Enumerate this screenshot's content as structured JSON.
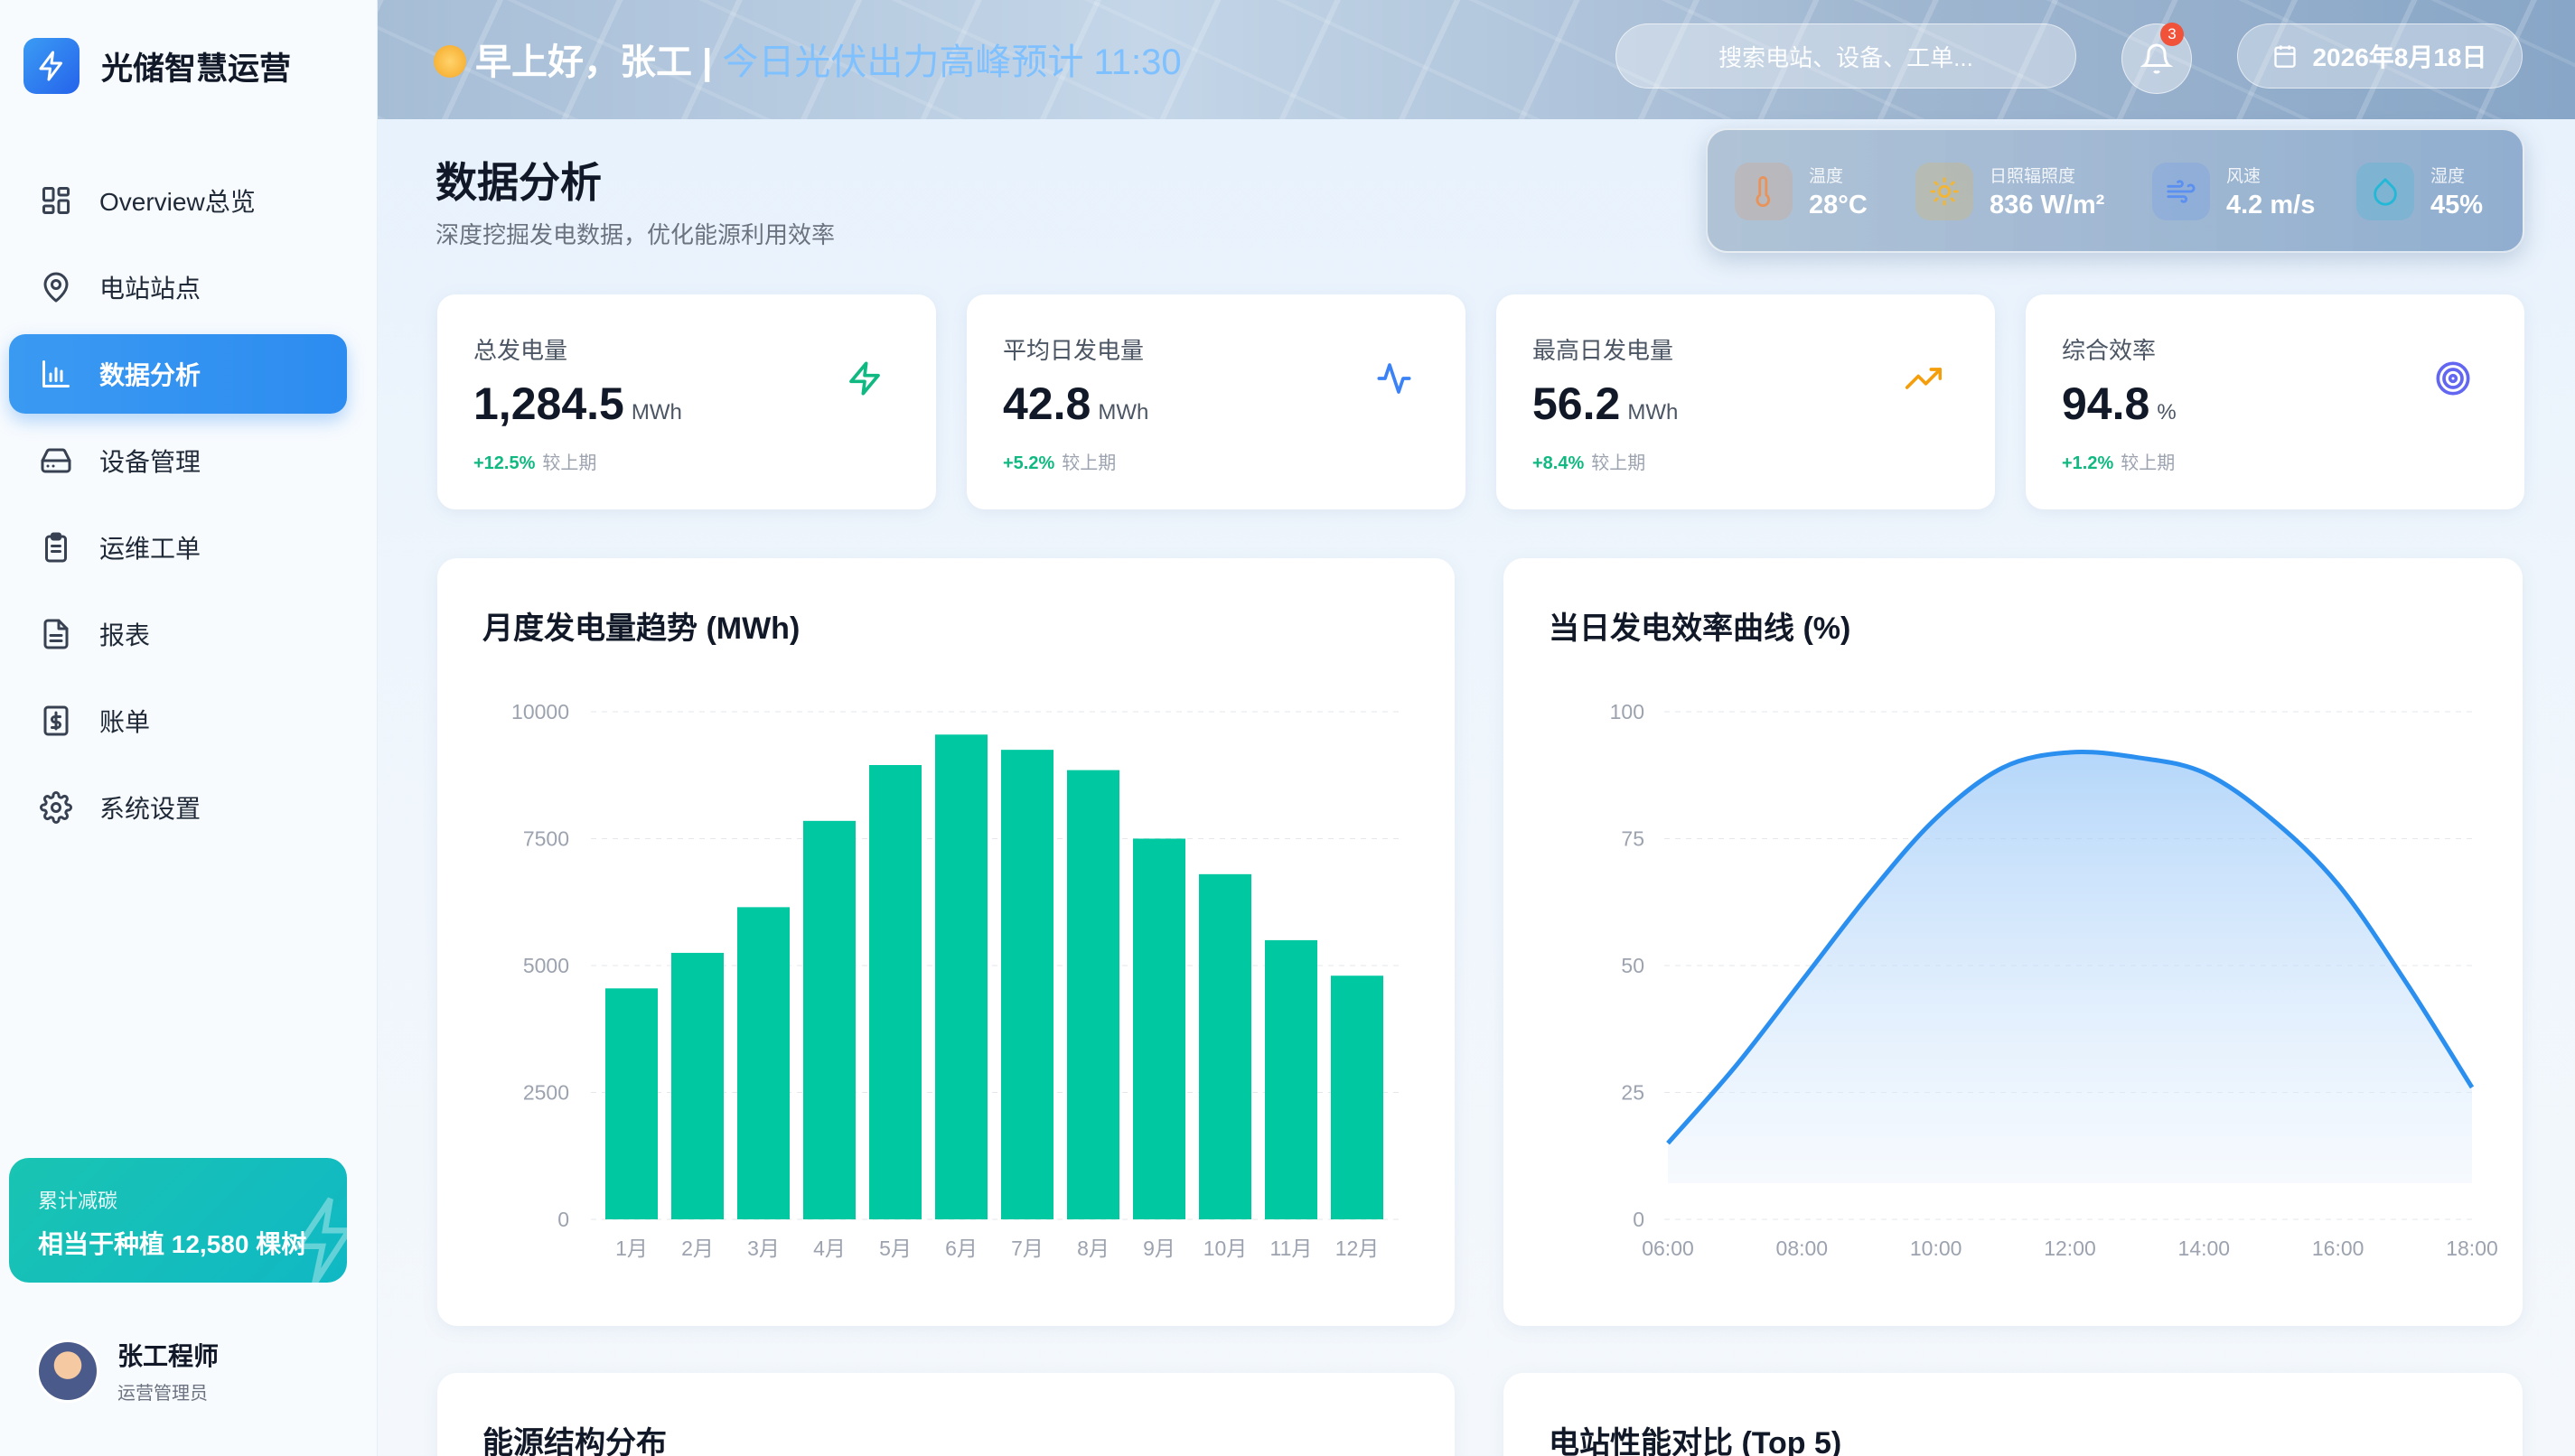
{
  "brand": {
    "name": "光储智慧运营"
  },
  "nav": [
    {
      "label": "Overview总览",
      "icon": "grid-icon"
    },
    {
      "label": "电站站点",
      "icon": "map-pin-icon"
    },
    {
      "label": "数据分析",
      "icon": "bar-chart-icon",
      "active": true
    },
    {
      "label": "设备管理",
      "icon": "hard-drive-icon"
    },
    {
      "label": "运维工单",
      "icon": "clipboard-icon"
    },
    {
      "label": "报表",
      "icon": "file-text-icon"
    },
    {
      "label": "账单",
      "icon": "dollar-icon"
    },
    {
      "label": "系统设置",
      "icon": "gear-icon"
    }
  ],
  "carbon": {
    "label": "累计减碳",
    "value": "相当于种植 12,580 棵树"
  },
  "user": {
    "name": "张工程师",
    "role": "运营管理员"
  },
  "header": {
    "greeting": "早上好，张工 | ",
    "peak": "今日光伏出力高峰预计 11:30",
    "search_placeholder": "搜索电站、设备、工单...",
    "notifications": "3",
    "date": "2026年8月18日"
  },
  "page": {
    "title": "数据分析",
    "subtitle": "深度挖掘发电数据，优化能源利用效率"
  },
  "weather": [
    {
      "label": "温度",
      "value": "28°C",
      "icon": "thermometer-icon",
      "color": "#e8935a"
    },
    {
      "label": "日照辐照度",
      "value": "836 W/m²",
      "icon": "sun-icon",
      "color": "#f2b534"
    },
    {
      "label": "风速",
      "value": "4.2 m/s",
      "icon": "wind-icon",
      "color": "#5b8ff0"
    },
    {
      "label": "湿度",
      "value": "45%",
      "icon": "droplet-icon",
      "color": "#22b8d6"
    }
  ],
  "stats": [
    {
      "label": "总发电量",
      "value": "1,284.5",
      "unit": "MWh",
      "change": "+12.5%",
      "change_label": "较上期",
      "icon": "zap-icon",
      "color": "#10b981"
    },
    {
      "label": "平均日发电量",
      "value": "42.8",
      "unit": "MWh",
      "change": "+5.2%",
      "change_label": "较上期",
      "icon": "activity-icon",
      "color": "#3b82f6"
    },
    {
      "label": "最高日发电量",
      "value": "56.2",
      "unit": "MWh",
      "change": "+8.4%",
      "change_label": "较上期",
      "icon": "trending-up-icon",
      "color": "#f59e0b"
    },
    {
      "label": "综合效率",
      "value": "94.8",
      "unit": "%",
      "change": "+1.2%",
      "change_label": "较上期",
      "icon": "target-icon",
      "color": "#6366f1"
    }
  ],
  "charts": {
    "monthly_title": "月度发电量趋势 (MWh)",
    "efficiency_title": "当日发电效率曲线 (%)",
    "energy_title": "能源结构分布",
    "station_title": "电站性能对比 (Top 5)"
  },
  "chart_data": [
    {
      "type": "bar",
      "title": "月度发电量趋势 (MWh)",
      "categories": [
        "1月",
        "2月",
        "3月",
        "4月",
        "5月",
        "6月",
        "7月",
        "8月",
        "9月",
        "10月",
        "11月",
        "12月"
      ],
      "values": [
        4550,
        5250,
        6150,
        7850,
        8950,
        9550,
        9250,
        8850,
        7500,
        6800,
        5500,
        4800
      ],
      "ylim": [
        0,
        10000
      ],
      "yticks": [
        0,
        2500,
        5000,
        7500,
        10000
      ],
      "color": "#00c9a1",
      "grid": true
    },
    {
      "type": "area",
      "title": "当日发电效率曲线 (%)",
      "x": [
        "06:00",
        "07:00",
        "08:00",
        "09:00",
        "10:00",
        "11:00",
        "12:00",
        "13:00",
        "14:00",
        "15:00",
        "16:00",
        "17:00",
        "18:00"
      ],
      "values": [
        15,
        30,
        47,
        64,
        79,
        89,
        92,
        91,
        88,
        79,
        66,
        47,
        26
      ],
      "xticks": [
        "06:00",
        "08:00",
        "10:00",
        "12:00",
        "14:00",
        "16:00",
        "18:00"
      ],
      "ylim": [
        0,
        100
      ],
      "yticks": [
        0,
        25,
        50,
        75,
        100
      ],
      "color": "#2b8ff0",
      "grid": true
    }
  ]
}
